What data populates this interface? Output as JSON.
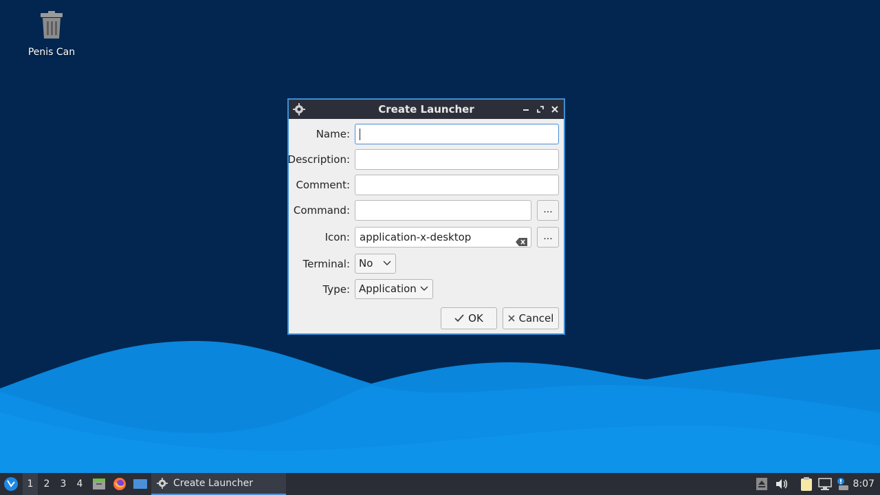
{
  "desktop": {
    "trash_label": "Penis Can"
  },
  "dialog": {
    "title": "Create Launcher",
    "fields": {
      "name_label": "Name:",
      "name_value": "",
      "description_label": "Description:",
      "description_value": "",
      "comment_label": "Comment:",
      "comment_value": "",
      "command_label": "Command:",
      "command_value": "",
      "icon_label": "Icon:",
      "icon_value": "application-x-desktop",
      "terminal_label": "Terminal:",
      "terminal_value": "No",
      "type_label": "Type:",
      "type_value": "Application",
      "browse_label": "..."
    },
    "ok_label": "OK",
    "cancel_label": "Cancel"
  },
  "taskbar": {
    "workspaces": [
      "1",
      "2",
      "3",
      "4"
    ],
    "active_task": "Create Launcher",
    "clock": "8:07"
  },
  "colors": {
    "desktop_bg": "#032650",
    "accent": "#4a90d9",
    "titlebar": "#2c2f3a",
    "taskbar": "#2a2d35"
  }
}
